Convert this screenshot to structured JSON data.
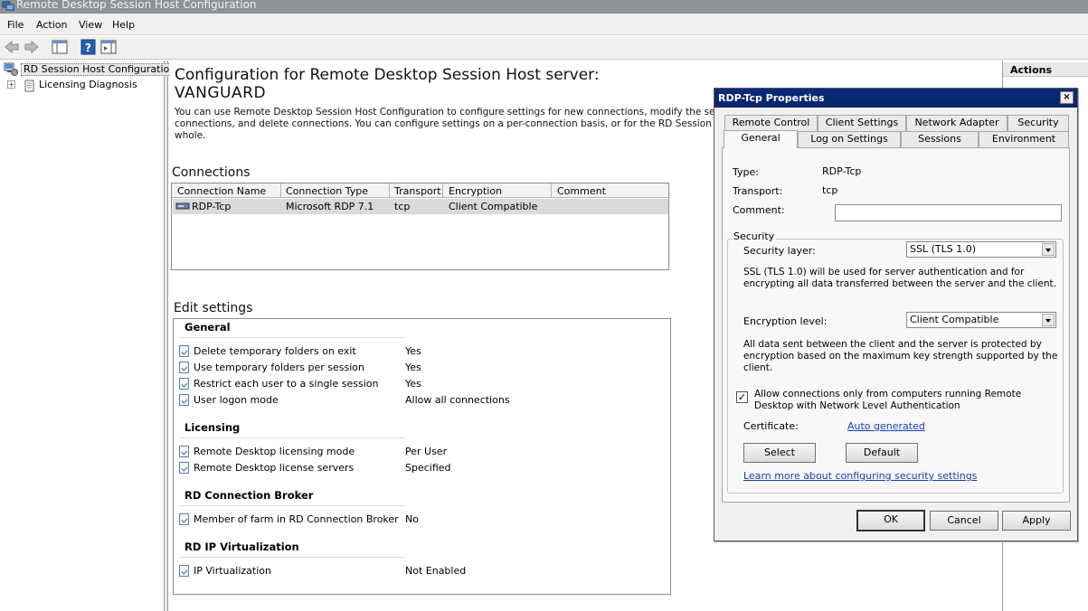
{
  "window": {
    "title": "Remote Desktop Session Host Configuration"
  },
  "menu": {
    "file": "File",
    "action": "Action",
    "view": "View",
    "help": "Help"
  },
  "tree": {
    "root": "RD Session Host Configuration:",
    "child": "Licensing Diagnosis"
  },
  "main": {
    "title": "Configuration for Remote Desktop Session Host server:",
    "server": "VANGUARD",
    "intro_line1": "You can use Remote Desktop Session Host Configuration to configure settings for new connections, modify the settings of exis",
    "intro_line2": "connections, and delete connections. You can configure settings on a per-connection basis, or for the RD Session Host server",
    "intro_line3": "whole.",
    "connections_heading": "Connections",
    "columns": {
      "name": "Connection Name",
      "type": "Connection Type",
      "transport": "Transport",
      "encryption": "Encryption",
      "comment": "Comment"
    },
    "row": {
      "name": "RDP-Tcp",
      "type": "Microsoft RDP 7.1",
      "transport": "tcp",
      "encryption": "Client Compatible",
      "comment": ""
    },
    "edit_heading": "Edit settings",
    "groups": {
      "general": {
        "title": "General",
        "s1": {
          "label": "Delete temporary folders on exit",
          "value": "Yes"
        },
        "s2": {
          "label": "Use temporary folders per session",
          "value": "Yes"
        },
        "s3": {
          "label": "Restrict each user to a single session",
          "value": "Yes"
        },
        "s4": {
          "label": "User logon mode",
          "value": "Allow all connections"
        }
      },
      "licensing": {
        "title": "Licensing",
        "s1": {
          "label": "Remote Desktop licensing mode",
          "value": "Per User"
        },
        "s2": {
          "label": "Remote Desktop license servers",
          "value": "Specified"
        }
      },
      "broker": {
        "title": "RD Connection Broker",
        "s1": {
          "label": "Member of farm in RD Connection Broker",
          "value": "No"
        }
      },
      "ipvirt": {
        "title": "RD IP Virtualization",
        "s1": {
          "label": "IP Virtualization",
          "value": "Not Enabled"
        }
      }
    }
  },
  "actions": {
    "title": "Actions"
  },
  "dialog": {
    "title": "RDP-Tcp Properties",
    "close": "×",
    "tabs": {
      "remote_control": "Remote Control",
      "client_settings": "Client Settings",
      "network_adapter": "Network Adapter",
      "security": "Security",
      "general": "General",
      "log_on_settings": "Log on Settings",
      "sessions": "Sessions",
      "environment": "Environment"
    },
    "type_label": "Type:",
    "type_value": "RDP-Tcp",
    "transport_label": "Transport:",
    "transport_value": "tcp",
    "comment_label": "Comment:",
    "comment_value": "",
    "security_group": "Security",
    "security_layer_label": "Security layer:",
    "security_layer_value": "SSL (TLS 1.0)",
    "security_layer_desc": "SSL (TLS 1.0) will be used for server authentication and for encrypting all data transferred between the server and the client.",
    "encryption_level_label": "Encryption level:",
    "encryption_level_value": "Client Compatible",
    "encryption_desc": "All data sent between the client and the server is protected by encryption based on the maximum key strength supported by the client.",
    "nla_checked": "✓",
    "nla_label": "Allow connections only from computers running Remote Desktop with Network Level Authentication",
    "certificate_label": "Certificate:",
    "certificate_link": "Auto generated",
    "select_button": "Select",
    "default_button": "Default",
    "learn_more_link": "Learn more about configuring security settings",
    "ok_button": "OK",
    "cancel_button": "Cancel",
    "apply_button": "Apply"
  }
}
